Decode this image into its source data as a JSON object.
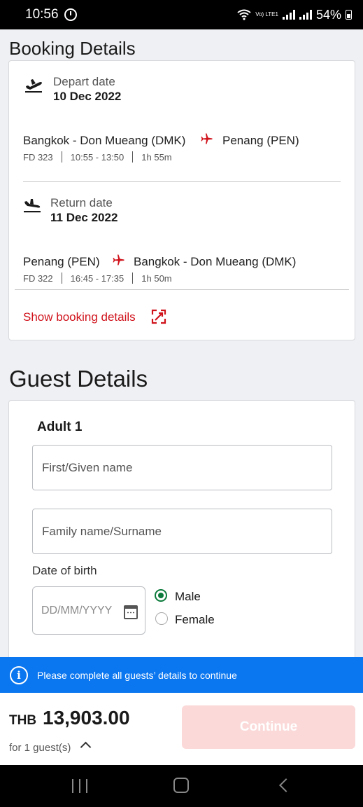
{
  "status_bar": {
    "time": "10:56",
    "network": "Vo) LTE1",
    "battery": "54%"
  },
  "booking": {
    "title": "Booking Details",
    "depart": {
      "label": "Depart date",
      "date": "10 Dec 2022",
      "from": "Bangkok - Don Mueang (DMK)",
      "to": "Penang (PEN)",
      "flight": "FD 323",
      "time": "10:55 - 13:50",
      "duration": "1h 55m"
    },
    "return": {
      "label": "Return date",
      "date": "11 Dec 2022",
      "from": "Penang (PEN)",
      "to": "Bangkok - Don Mueang (DMK)",
      "flight": "FD 322",
      "time": "16:45 - 17:35",
      "duration": "1h 50m"
    },
    "show_details_label": "Show booking details"
  },
  "guest": {
    "title": "Guest Details",
    "adult_label": "Adult 1",
    "first_name_placeholder": "First/Given name",
    "family_name_placeholder": "Family name/Surname",
    "dob_label": "Date of birth",
    "dob_placeholder": "DD/MM/YYYY",
    "gender_options": [
      "Male",
      "Female"
    ],
    "gender_selected": "Male"
  },
  "banner": {
    "message": "Please complete all guests’ details to continue"
  },
  "footer": {
    "currency": "THB",
    "amount": "13,903.00",
    "guests_label": "for 1 guest(s)",
    "continue_label": "Continue"
  },
  "colors": {
    "accent_red": "#d0121b",
    "banner_blue": "#0a76f0",
    "radio_green": "#0b7a3b",
    "disabled_button": "#fbd9d9"
  }
}
